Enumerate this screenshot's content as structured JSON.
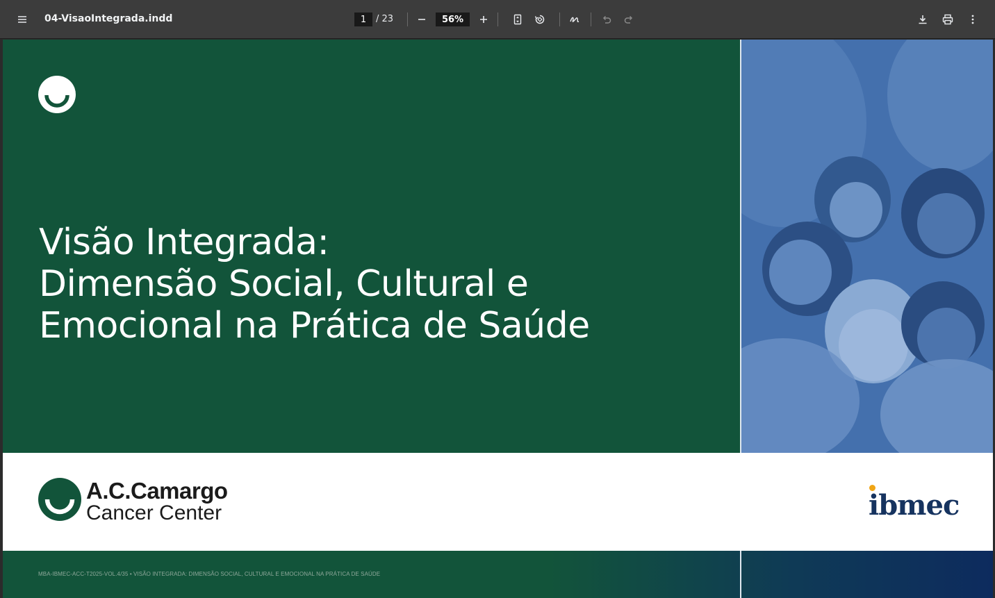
{
  "toolbar": {
    "doc_title": "04-VisaoIntegrada.indd",
    "current_page": "1",
    "total_pages": "/ 23",
    "zoom": "56%",
    "icons": [
      "menu-icon",
      "zoom-out-icon",
      "zoom-in-icon",
      "fit-page-icon",
      "rotate-icon",
      "annotate-icon",
      "undo-icon",
      "redo-icon",
      "download-icon",
      "print-icon",
      "more-icon"
    ]
  },
  "slide": {
    "title_lines": [
      "Visão Integrada:",
      "Dimensão Social, Cultural e",
      "Emocional na Prática de Saúde"
    ],
    "logo_left_name": "A.C.Camargo",
    "logo_left_sub": "Cancer Center",
    "logo_right": "ibmec",
    "footer": "MBA-IBMEC-ACC-T2025-VOL.4/35 • VISÃO INTEGRADA: DIMENSÃO SOCIAL, CULTURAL E EMOCIONAL NA PRÁTICA DE SAÚDE"
  },
  "colors": {
    "brand_green": "#12543a",
    "photo_blue": "#4a76b2",
    "ibmec_navy": "#16335f",
    "ibmec_accent": "#f0a515",
    "toolbar_bg": "#3c3c3c"
  }
}
